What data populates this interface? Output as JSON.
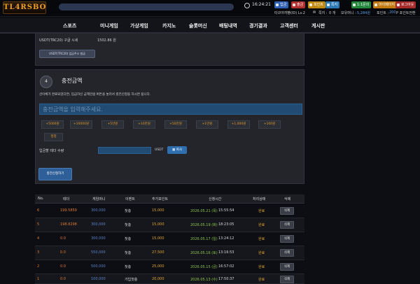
{
  "header": {
    "logo_text": "TL4RSBO",
    "clock": "16:24:21",
    "buttons": [
      "입금",
      "출금",
      "포인트",
      "쪽지",
      "1:1문의",
      "마이페이지",
      "로그아웃"
    ],
    "user_name": "타코야끼빵(ID) Lv.2",
    "memo_label": "쪽지 :",
    "memo_count": "0 개",
    "balance_label": "보유머니 :",
    "balance_value": "5,284원",
    "point_label": "포인트 :",
    "point_value": "200",
    "point_convert": "P 포인트전환"
  },
  "nav": [
    "스포츠",
    "미니게임",
    "가상게임",
    "카지노",
    "슬롯머신",
    "배팅내역",
    "경기결과",
    "고객센터",
    "게시판"
  ],
  "rate_panel": {
    "label": "USDT(TRC20) 구글 시세",
    "value": "1502.86 원",
    "address_button": "USDT(TRC20) 입금주소 발급"
  },
  "charge_panel": {
    "step": "4",
    "title": "충전금액",
    "description": "선이체가 완료되었다면, 입금하신 금액만큼 버튼을 눌러서 충전신청을 하시면 됩니다.",
    "amount_placeholder": "충전금액을 입력해주세요.",
    "amount_buttons": [
      "+5000원",
      "+10000원",
      "+5만원",
      "+10만원",
      "+50만원",
      "+1만원",
      "+1,000원",
      "+100원"
    ],
    "reset_button": "정정",
    "tether_label": "입금할 테더 수량",
    "tether_value": "",
    "tether_unit": "USDT",
    "copy_button": "복사",
    "submit_button": "충전신청하기"
  },
  "history": {
    "columns": [
      "No.",
      "테더",
      "게임머니",
      "이벤트",
      "추가포인트",
      "신청시간",
      "처리상태",
      "삭제"
    ],
    "rows": [
      {
        "no": "6",
        "tether": "199.5859",
        "money": "300,000",
        "event": "첫충",
        "bonus": "15,000",
        "date": "2026.05.21 (목)",
        "time": "15:55:54",
        "status": "완료",
        "del": "삭제"
      },
      {
        "no": "5",
        "tether": "198.8298",
        "money": "300,000",
        "event": "첫충",
        "bonus": "15,000",
        "date": "2026.05.19 (화)",
        "time": "18:23:05",
        "status": "완료",
        "del": "삭제"
      },
      {
        "no": "4",
        "tether": "0.0",
        "money": "300,000",
        "event": "첫충",
        "bonus": "15,000",
        "date": "2026.05.17 (일)",
        "time": "13:24:12",
        "status": "완료",
        "del": "삭제"
      },
      {
        "no": "3",
        "tether": "0.0",
        "money": "550,000",
        "event": "첫충",
        "bonus": "27,500",
        "date": "2026.05.16 (토)",
        "time": "13:16:53",
        "status": "완료",
        "del": "삭제"
      },
      {
        "no": "2",
        "tether": "0.0",
        "money": "500,000",
        "event": "첫충",
        "bonus": "25,000",
        "date": "2026.05.15 (금)",
        "time": "16:57:02",
        "status": "완료",
        "del": "삭제"
      },
      {
        "no": "1",
        "tether": "0.0",
        "money": "100,000",
        "event": "가입첫충",
        "bonus": "20,000",
        "date": "2026.05.13 (수)",
        "time": "17:50:37",
        "status": "완료",
        "del": "삭제"
      }
    ]
  }
}
